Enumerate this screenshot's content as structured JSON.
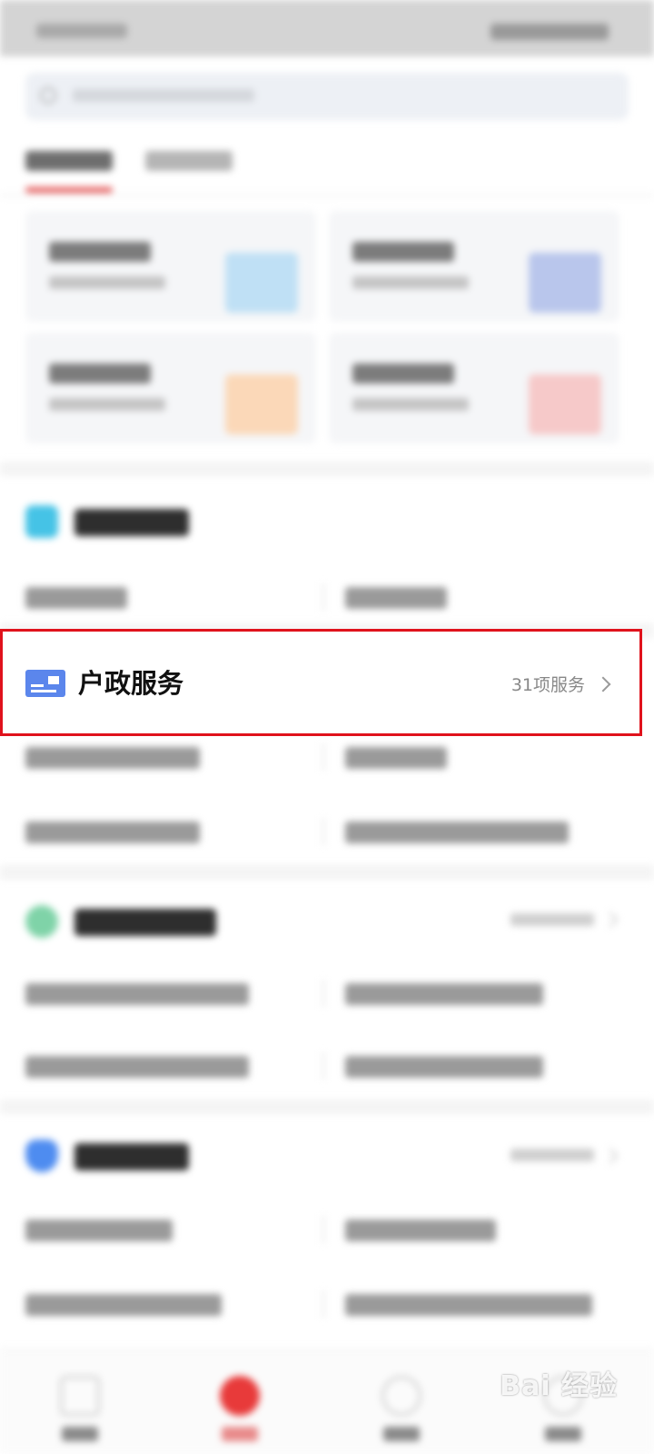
{
  "highlighted_section": {
    "title": "户政服务",
    "count_label": "31项服务",
    "icon": "id-card-icon",
    "icon_color": "#5b86ec",
    "highlight_color": "#e0121c"
  },
  "watermark": {
    "text": "Bai 经验"
  },
  "colors": {
    "accent": "#e35555",
    "tab_home_icon": "#e83a3a"
  }
}
